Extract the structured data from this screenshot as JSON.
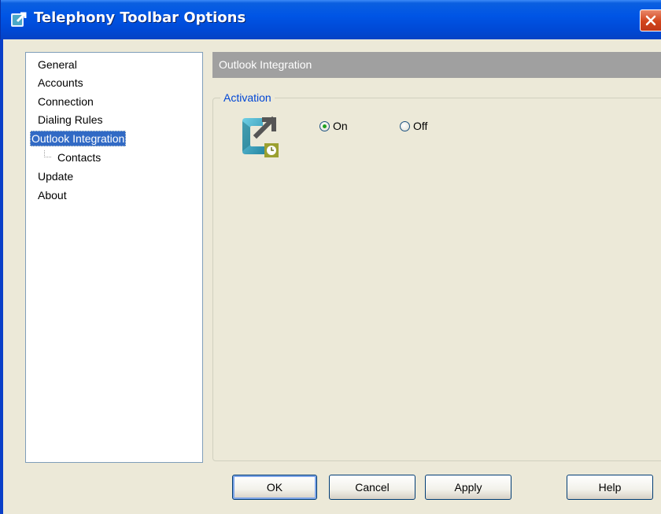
{
  "window": {
    "title": "Telephony Toolbar Options"
  },
  "tree": {
    "items": [
      {
        "label": "General"
      },
      {
        "label": "Accounts"
      },
      {
        "label": "Connection"
      },
      {
        "label": "Dialing Rules"
      },
      {
        "label": "Outlook Integration",
        "selected": true
      },
      {
        "label": "Contacts",
        "child": true
      },
      {
        "label": "Update"
      },
      {
        "label": "About"
      }
    ]
  },
  "panel": {
    "header": "Outlook Integration",
    "group_label": "Activation",
    "radio_on": "On",
    "radio_off": "Off",
    "selected": "On"
  },
  "buttons": {
    "ok": "OK",
    "cancel": "Cancel",
    "apply": "Apply",
    "help": "Help"
  },
  "colors": {
    "titlebar": "#0055E5",
    "selection": "#316AC5",
    "section_header": "#A0A0A0",
    "group_label": "#0046D5"
  }
}
